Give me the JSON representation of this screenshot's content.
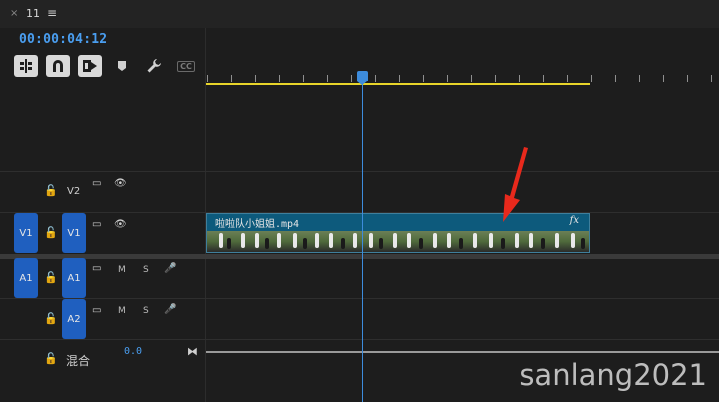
{
  "tab": {
    "close": "×",
    "title": "11",
    "menu": "≡"
  },
  "timecode": "00:00:04:12",
  "tools": [
    {
      "name": "insert-nest-icon",
      "glyph": "⇥",
      "on": true
    },
    {
      "name": "snap-magnet-icon",
      "glyph": "∩",
      "on": true
    },
    {
      "name": "linked-selection-icon",
      "glyph": "▶",
      "on": true
    },
    {
      "name": "add-marker-icon",
      "glyph": "⬟",
      "on": false
    },
    {
      "name": "wrench-icon",
      "glyph": "🔧",
      "on": false
    },
    {
      "name": "captions-icon",
      "glyph": "CC",
      "on": false
    }
  ],
  "tracks": {
    "v2": {
      "name": "V2",
      "lock": "🔓",
      "clip_icon": "▭",
      "eye": "👁"
    },
    "v1": {
      "target": "V1",
      "name": "V1",
      "lock": "🔓",
      "clip_icon": "▭",
      "eye": "👁"
    },
    "a1": {
      "target": "A1",
      "name": "A1",
      "lock": "🔓",
      "clip_icon": "▭",
      "m": "M",
      "s": "S",
      "mic": "🎤"
    },
    "a2": {
      "name": "A2",
      "lock": "🔓",
      "clip_icon": "▭",
      "m": "M",
      "s": "S",
      "mic": "🎤"
    },
    "mix": {
      "name": "混合",
      "lock": "🔓",
      "value": "0.0",
      "end_icon": "⧓"
    }
  },
  "clip": {
    "title": "啦啦队小姐姐.mp4",
    "fx": "fx"
  },
  "watermark": "sanlang2021",
  "colors": {
    "accent": "#4a9ef0",
    "track_target": "#1f5fbf",
    "clip": "#0d5a7c",
    "workarea": "#e8d52a",
    "arrow": "#e8291c"
  }
}
